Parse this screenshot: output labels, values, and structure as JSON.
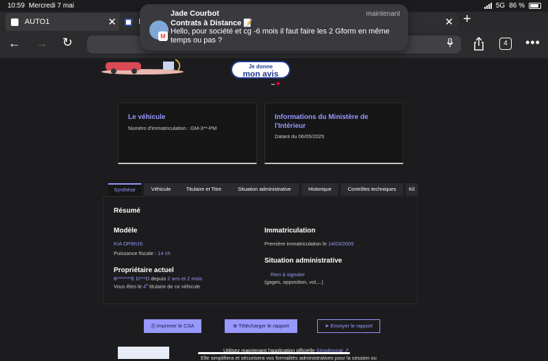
{
  "status_bar": {
    "time": "10:59",
    "date": "Mercredi 7 mai",
    "network": "5G",
    "battery": "86 %"
  },
  "browser": {
    "tabs": [
      {
        "title": "AUTO1"
      },
      {
        "title": "I"
      }
    ],
    "tab_count": "4"
  },
  "notification": {
    "sender": "Jade Courbot",
    "subject": "Contrats à Distance 📝",
    "message": "Hello, pour société et cg -6 mois il faut faire les 2 Gform en même temps ou pas ?",
    "time": "maintenant",
    "app_badge": "M"
  },
  "page": {
    "avis_button": {
      "line1": "Je donne",
      "line2": "mon avis"
    },
    "card_vehicle": {
      "title": "Le véhicule",
      "plate": "Numéro d'immatriculation : GM-3**-PM"
    },
    "card_ministry": {
      "title_l1": "Informations du Ministère de",
      "title_l2": "l'Intérieur",
      "date": "Datant du 06/05/2025"
    },
    "tabs": [
      "Synthèse",
      "Véhicule",
      "Titulaire et Titre",
      "Situation administrative",
      "Historique",
      "Contrôles techniques",
      "Kil"
    ],
    "summary": {
      "heading": "Résumé",
      "model_heading": "Modèle",
      "model": "KIA OPIRUS",
      "power_label": "Puissance fiscale :",
      "power_value": "14 ch",
      "owner_heading": "Propriétaire actuel",
      "owner_name": "B*******E D***D",
      "owner_since_label": "depuis",
      "owner_since": "2 ans et 2 mois",
      "holder_prefix": "Vous êtes le",
      "holder_rank": "4",
      "holder_sup": "e",
      "holder_suffix": "titulaire de ce véhicule",
      "reg_heading": "Immatriculation",
      "reg_label": "Première immatriculation le",
      "reg_date": "14/03/2005",
      "admin_heading": "Situation administrative",
      "admin_status": "Rien à signaler",
      "admin_detail": "(gages, opposition, vol,...)"
    },
    "actions": {
      "print": "Imprimer le CSA",
      "download": "Télécharger le rapport",
      "send": "Envoyer le rapport"
    },
    "footer": {
      "line1_prefix": "Utilisez maintenant l'application officielle",
      "line1_link": "Simplimmat",
      "line2": "Elle simplifiera et sécurisera vos formalités administratives pour la cession ou"
    }
  }
}
